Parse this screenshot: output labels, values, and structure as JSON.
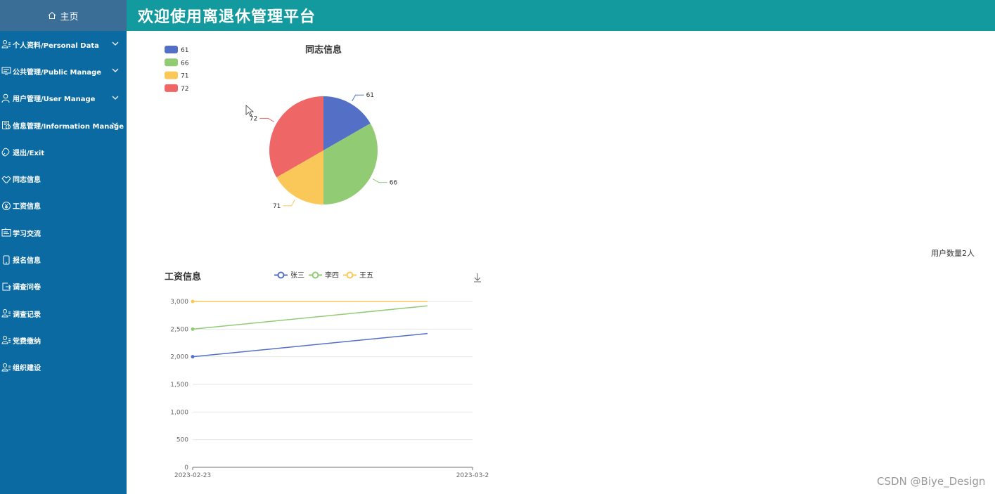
{
  "sidebar": {
    "home_label": "主页",
    "items": [
      {
        "label": "个人资料/Personal Data",
        "icon": "user-card-icon",
        "expandable": true
      },
      {
        "label": "公共管理/Public Manage",
        "icon": "monitor-icon",
        "expandable": true
      },
      {
        "label": "用户管理/User Manage",
        "icon": "user-icon",
        "expandable": true
      },
      {
        "label": "信息管理/Information Manage",
        "icon": "info-doc-icon",
        "expandable": true
      },
      {
        "label": "退出/Exit",
        "icon": "exit-icon",
        "expandable": false
      },
      {
        "label": "同志信息",
        "icon": "handshake-icon",
        "expandable": false
      },
      {
        "label": "工资信息",
        "icon": "coin-icon",
        "expandable": false
      },
      {
        "label": "学习交流",
        "icon": "board-icon",
        "expandable": false
      },
      {
        "label": "报名信息",
        "icon": "phone-icon",
        "expandable": false
      },
      {
        "label": "调查问卷",
        "icon": "export-icon",
        "expandable": false
      },
      {
        "label": "调查记录",
        "icon": "user-list-icon",
        "expandable": false
      },
      {
        "label": "党费缴纳",
        "icon": "user-list-icon",
        "expandable": false
      },
      {
        "label": "组织建设",
        "icon": "user-list-icon",
        "expandable": false
      }
    ]
  },
  "header": {
    "title": "欢迎使用离退休管理平台"
  },
  "user_count": "用户数量2人",
  "watermark": "CSDN @Biye_Design",
  "colors": {
    "sidebar": "#0a6aa1",
    "header": "#139a9e",
    "blue": "#5470c6",
    "green": "#91cc75",
    "yellow": "#fac858",
    "red": "#ee6666"
  },
  "chart_data": [
    {
      "type": "pie",
      "title": "同志信息",
      "legend": [
        "61",
        "66",
        "71",
        "72"
      ],
      "values": [
        61,
        66,
        71,
        72
      ],
      "colors": [
        "#5470c6",
        "#91cc75",
        "#fac858",
        "#ee6666"
      ],
      "shares": [
        0.167,
        0.333,
        0.167,
        0.333
      ]
    },
    {
      "type": "line",
      "title": "工资信息",
      "categories": [
        "2023-02-23",
        "2023-03-2"
      ],
      "ylim": [
        0,
        3000
      ],
      "yticks": [
        0,
        500,
        1000,
        1500,
        2000,
        2500,
        3000
      ],
      "ytick_labels": [
        "0",
        "500",
        "1,000",
        "1,500",
        "2,000",
        "2,500",
        "3,000"
      ],
      "series": [
        {
          "name": "张三",
          "values": [
            2000,
            2420
          ],
          "color": "#5470c6"
        },
        {
          "name": "李四",
          "values": [
            2500,
            2920
          ],
          "color": "#91cc75"
        },
        {
          "name": "王五",
          "values": [
            3000,
            3000
          ],
          "color": "#fac858"
        }
      ],
      "download_icon": "download-icon"
    }
  ]
}
